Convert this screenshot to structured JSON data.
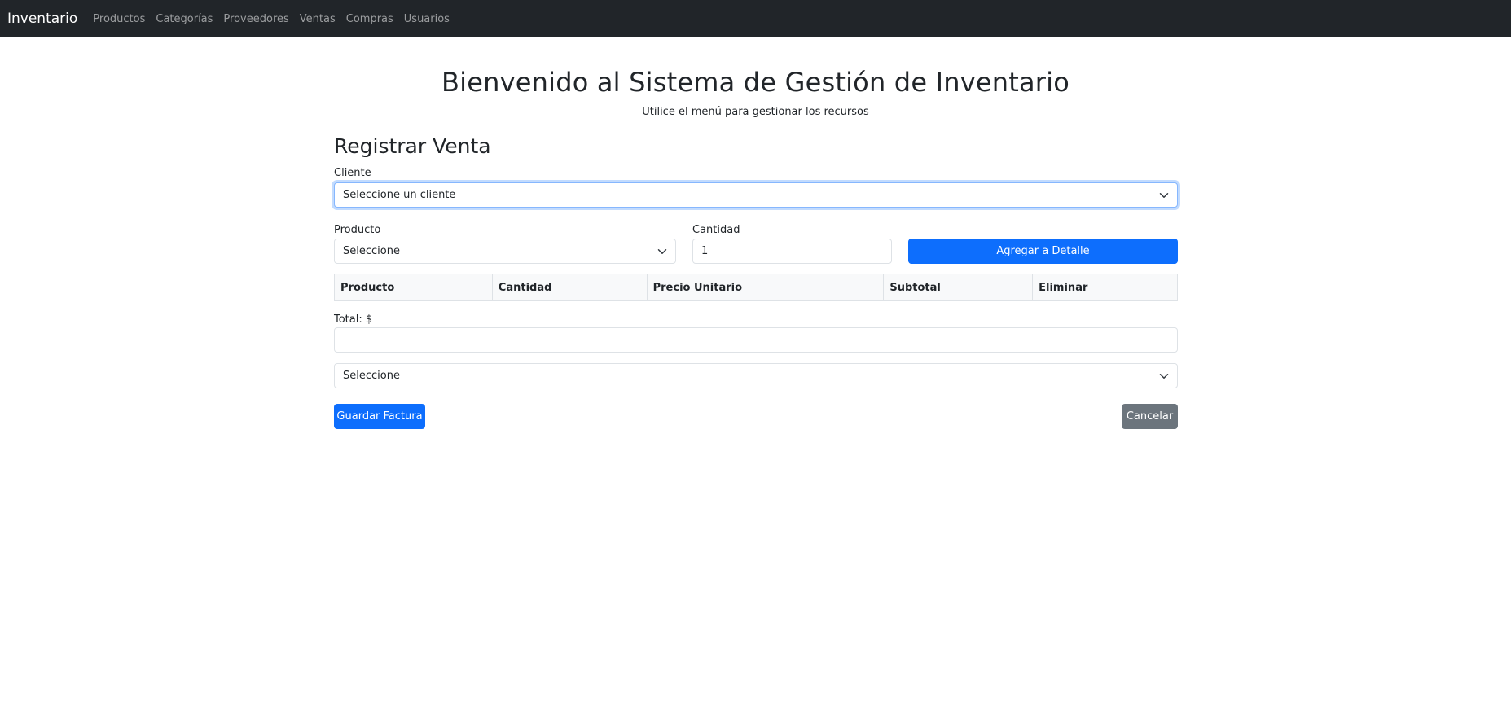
{
  "navbar": {
    "brand": "Inventario",
    "links": [
      "Productos",
      "Categorías",
      "Proveedores",
      "Ventas",
      "Compras",
      "Usuarios"
    ]
  },
  "header": {
    "title": "Bienvenido al Sistema de Gestión de Inventario",
    "subtitle": "Utilice el menú para gestionar los recursos"
  },
  "form": {
    "title": "Registrar Venta",
    "cliente_label": "Cliente",
    "cliente_selected": "Seleccione un cliente",
    "producto_label": "Producto",
    "producto_selected": "Seleccione",
    "cantidad_label": "Cantidad",
    "cantidad_value": "1",
    "add_detail_button": "Agregar a Detalle",
    "table_headers": [
      "Producto",
      "Cantidad",
      "Precio Unitario",
      "Subtotal",
      "Eliminar"
    ],
    "total_label": "Total: $",
    "total_value": "",
    "payment_selected": "Seleccione",
    "save_button": "Guardar Factura",
    "cancel_button": "Cancelar"
  },
  "colors": {
    "navbar_bg": "#212529",
    "primary": "#0d6efd",
    "secondary": "#6c757d"
  }
}
